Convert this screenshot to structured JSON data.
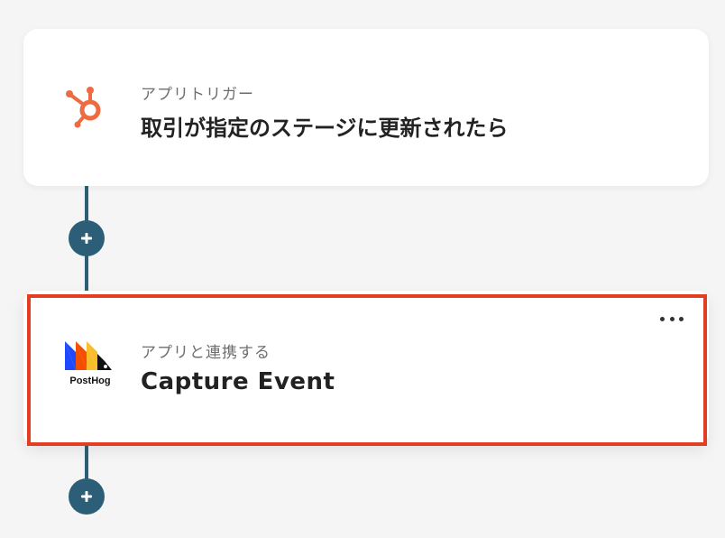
{
  "steps": [
    {
      "app": "HubSpot",
      "icon": "hubspot-icon",
      "subtitle": "アプリトリガー",
      "title": "取引が指定のステージに更新されたら"
    },
    {
      "app": "PostHog",
      "icon": "posthog-icon",
      "logo_text": "PostHog",
      "subtitle": "アプリと連携する",
      "title": "Capture Event",
      "selected": true
    }
  ],
  "colors": {
    "background": "#f5f5f6",
    "connector": "#2c5f77",
    "highlight": "#e33e22",
    "hubspot": "#ef6a40"
  },
  "icons": {
    "add": "plus-icon",
    "more": "more-horizontal-icon"
  }
}
